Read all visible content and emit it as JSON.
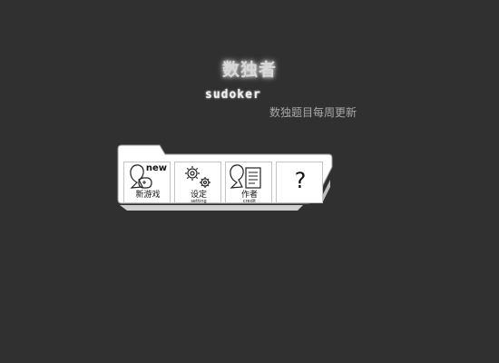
{
  "header": {
    "title": "数独者",
    "logo_text": "sudoker",
    "subtitle": "数独题目每周更新"
  },
  "menu": {
    "items": [
      {
        "id": "new-game",
        "label": "新游戏",
        "badge": "new",
        "icon": "person-gamepad-icon"
      },
      {
        "id": "settings",
        "label": "设定",
        "sublabel": "setting",
        "icon": "gears-icon"
      },
      {
        "id": "credits",
        "label": "作者",
        "sublabel": "credit",
        "icon": "person-document-icon"
      },
      {
        "id": "help",
        "symbol": "?",
        "icon": "question-mark-icon"
      }
    ]
  },
  "colors": {
    "background": "#303030",
    "panel": "#ffffff",
    "subtitle": "#a9a9a9"
  }
}
